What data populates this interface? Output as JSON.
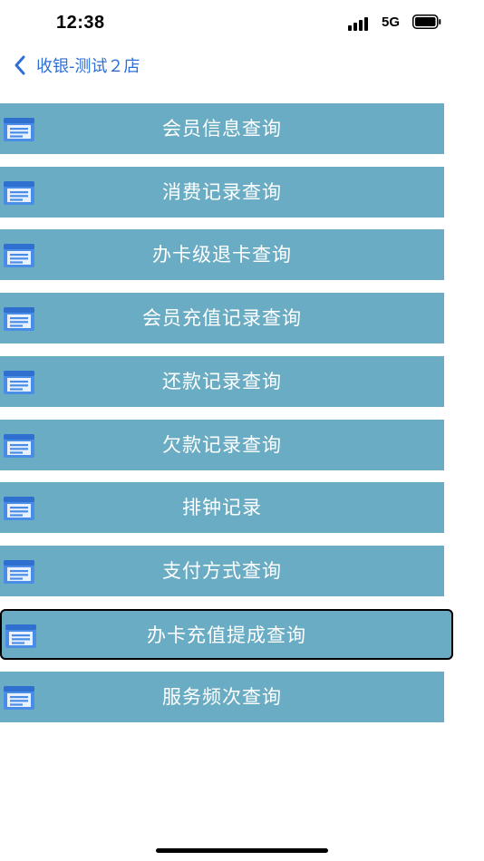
{
  "status_bar": {
    "time": "12:38",
    "network": "5G"
  },
  "nav": {
    "title": "收银-测试２店"
  },
  "menu": {
    "items": [
      {
        "label": "会员信息查询",
        "selected": false
      },
      {
        "label": "消费记录查询",
        "selected": false
      },
      {
        "label": "办卡级退卡查询",
        "selected": false
      },
      {
        "label": "会员充值记录查询",
        "selected": false
      },
      {
        "label": "还款记录查询",
        "selected": false
      },
      {
        "label": "欠款记录查询",
        "selected": false
      },
      {
        "label": "排钟记录",
        "selected": false
      },
      {
        "label": "支付方式查询",
        "selected": false
      },
      {
        "label": "办卡充值提成查询",
        "selected": true
      },
      {
        "label": "服务频次查询",
        "selected": false
      }
    ]
  },
  "colors": {
    "item_background": "#6aacc3",
    "item_text": "#ffffff",
    "nav_accent": "#2f6fd6",
    "icon": "#4a8de6"
  },
  "icons": {
    "back": "chevron-left-icon",
    "menu_item": "list-document-icon"
  }
}
